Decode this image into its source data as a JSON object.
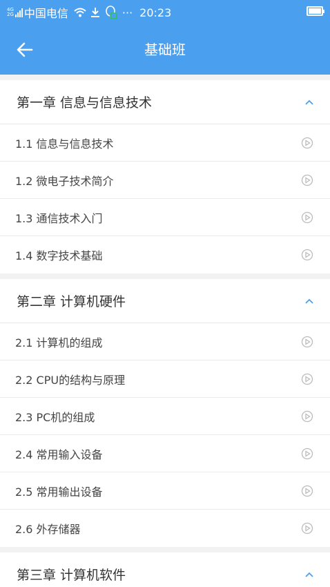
{
  "statusbar": {
    "network": "4G",
    "network2": "2G",
    "carrier": "中国电信",
    "more": "···",
    "time": "20:23"
  },
  "appbar": {
    "title": "基础班"
  },
  "chapters": [
    {
      "title": "第一章 信息与信息技术",
      "lessons": [
        "1.1 信息与信息技术",
        "1.2  微电子技术简介",
        "1.3  通信技术入门",
        "1.4  数字技术基础"
      ]
    },
    {
      "title": "第二章 计算机硬件",
      "lessons": [
        "2.1 计算机的组成",
        "2.2 CPU的结构与原理",
        "2.3  PC机的组成",
        "2.4  常用输入设备",
        "2.5  常用输出设备",
        "2.6   外存储器"
      ]
    },
    {
      "title": "第三章 计算机软件",
      "lessons": []
    }
  ],
  "colors": {
    "primary": "#4aa0ef",
    "chevron": "#4aa0ef",
    "play_icon": "#bbbbbb"
  }
}
